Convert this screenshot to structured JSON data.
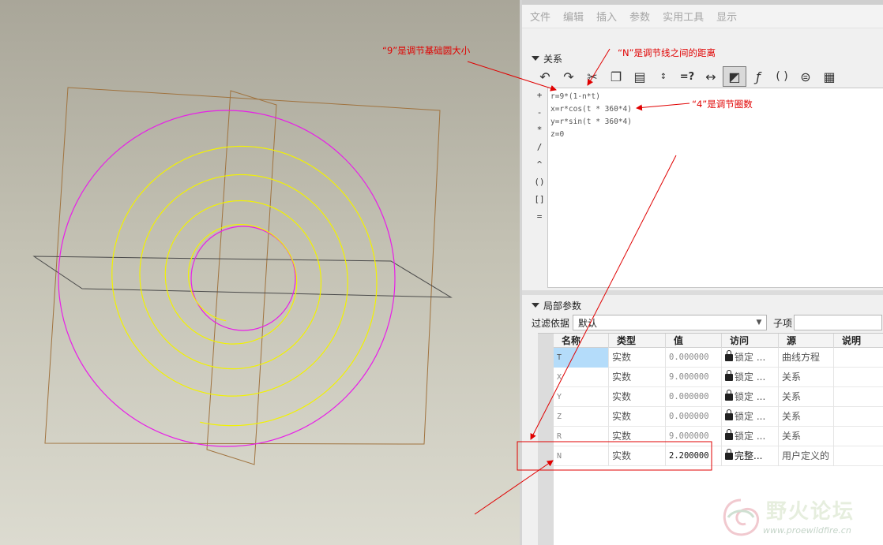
{
  "menu": [
    "文件",
    "编辑",
    "插入",
    "参数",
    "实用工具",
    "显示"
  ],
  "relations": {
    "section_title": "关系",
    "lines": [
      "r=9*(1-n*t)",
      "x=r*cos(t * 360*4)",
      "y=r*sin(t * 360*4)",
      "z=0"
    ],
    "operators": [
      "+",
      "-",
      "*",
      "/",
      "^",
      "()",
      "[]",
      "="
    ],
    "toolbar_icons": [
      "undo-icon",
      "redo-icon",
      "cut-icon",
      "copy-icon",
      "paste-icon",
      "evaluate-icon",
      "verify-icon",
      "dimension-icon",
      "display-icon",
      "function-icon",
      "parentheses-icon",
      "sort-icon",
      "execute-icon"
    ]
  },
  "local_params": {
    "section_title": "局部参数",
    "filter_label": "过滤依据",
    "filter_value": "默认",
    "child_label": "子项",
    "columns": [
      "名称",
      "类型",
      "值",
      "访问",
      "源",
      "说明"
    ],
    "rows": [
      {
        "name": "T",
        "type": "实数",
        "value": "0.000000",
        "access": "锁定 ...",
        "source": "曲线方程"
      },
      {
        "name": "X",
        "type": "实数",
        "value": "9.000000",
        "access": "锁定 ...",
        "source": "关系"
      },
      {
        "name": "Y",
        "type": "实数",
        "value": "0.000000",
        "access": "锁定 ...",
        "source": "关系"
      },
      {
        "name": "Z",
        "type": "实数",
        "value": "0.000000",
        "access": "锁定 ...",
        "source": "关系"
      },
      {
        "name": "R",
        "type": "实数",
        "value": "9.000000",
        "access": "锁定 ...",
        "source": "关系"
      },
      {
        "name": "N",
        "type": "实数",
        "value": "2.200000",
        "access": "完整...",
        "source": "用户定义的"
      }
    ]
  },
  "annotations": {
    "base_circle": "“9”是调节基础圆大小",
    "line_distance": "“N”是调节线之间的距离",
    "turns": "“4”是调节圈数"
  },
  "watermark": {
    "title": "野火论坛",
    "url": "www.proewildfire.cn"
  },
  "colors": {
    "annotation": "#e00000",
    "spiral": "#f2f200",
    "circle": "#e81ee8",
    "plane": "#a0733f"
  }
}
